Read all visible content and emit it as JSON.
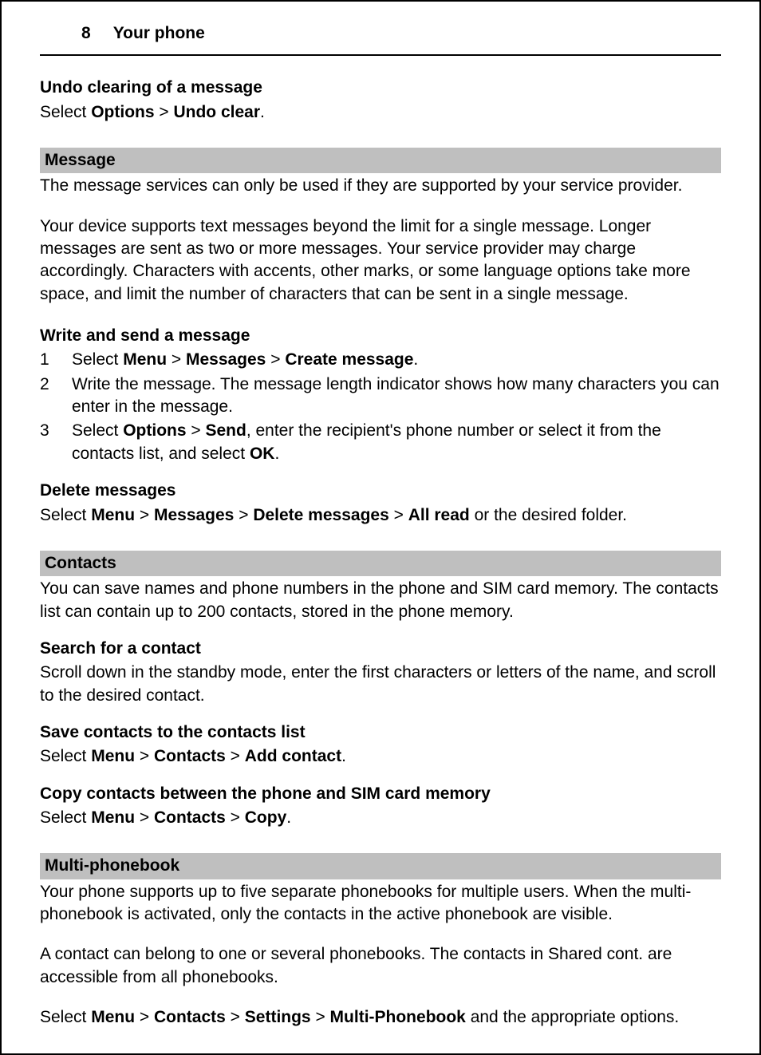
{
  "header": {
    "page_number": "8",
    "title": "Your phone"
  },
  "undo": {
    "title": "Undo clearing of a message",
    "select": "Select ",
    "options": "Options",
    "sep": " > ",
    "undo_clear": "Undo clear",
    "end": "."
  },
  "message": {
    "bar": "Message",
    "intro": "The message services can only be used if they are supported by your service provider.",
    "long": "Your device supports text messages beyond the limit for a single message. Longer messages are sent as two or more messages. Your service provider may charge accordingly. Characters with accents, other marks, or some language options take more space, and limit the number of characters that can be sent in a single message.",
    "write_title": "Write and send a message",
    "step1_a": "Select ",
    "step1_menu": "Menu",
    "step1_b": " > ",
    "step1_messages": "Messages",
    "step1_c": " > ",
    "step1_create": "Create message",
    "step1_d": ".",
    "step2": "Write the message. The message length indicator shows how many characters you can enter in the message.",
    "step3_a": "Select ",
    "step3_options": "Options",
    "step3_b": " > ",
    "step3_send": "Send",
    "step3_c": ", enter the recipient's phone number or select it from the contacts list, and select ",
    "step3_ok": "OK",
    "step3_d": ".",
    "delete_title": "Delete messages",
    "delete_a": "Select ",
    "delete_menu": "Menu",
    "delete_b": " > ",
    "delete_messages": "Messages",
    "delete_c": " > ",
    "delete_dm": "Delete messages",
    "delete_d": " > ",
    "delete_allread": "All read",
    "delete_e": " or the desired folder."
  },
  "contacts": {
    "bar": "Contacts",
    "intro": "You can save names and phone numbers in the phone and SIM card memory. The contacts list can contain up to 200 contacts, stored in the phone memory.",
    "search_title": "Search for a contact",
    "search_text": "Scroll down in the standby mode, enter the first characters or letters of the name, and scroll to the desired contact.",
    "save_title": "Save contacts to the contacts list",
    "save_a": "Select ",
    "save_menu": "Menu",
    "save_b": " > ",
    "save_contacts": "Contacts",
    "save_c": " > ",
    "save_add": "Add contact",
    "save_d": ".",
    "copy_title": "Copy contacts between the phone and SIM card memory",
    "copy_a": "Select ",
    "copy_menu": "Menu",
    "copy_b": " > ",
    "copy_contacts": "Contacts",
    "copy_c": " > ",
    "copy_copy": "Copy",
    "copy_d": "."
  },
  "multi": {
    "bar": "Multi-phonebook",
    "intro": "Your phone supports up to five separate phonebooks for multiple users. When the multi-phonebook is activated, only the contacts in the active phonebook are visible.",
    "intro2": "A contact can belong to one or several phonebooks. The contacts in Shared cont. are accessible from all phonebooks.",
    "sel_a": "Select ",
    "sel_menu": "Menu",
    "sel_b": " > ",
    "sel_contacts": "Contacts",
    "sel_c": " > ",
    "sel_settings": "Settings",
    "sel_d": " > ",
    "sel_mpb": "Multi-Phonebook",
    "sel_e": " and the appropriate options."
  }
}
